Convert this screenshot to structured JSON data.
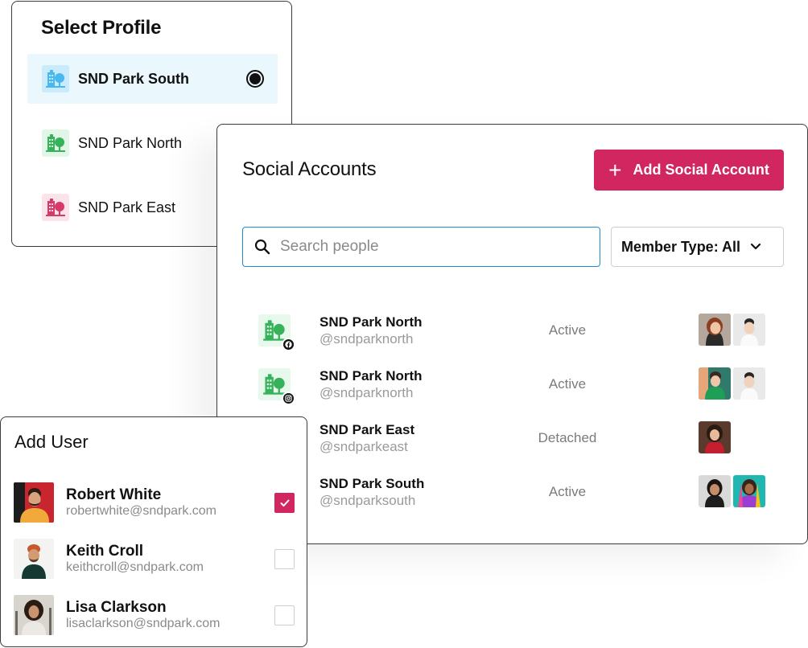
{
  "colors": {
    "accent": "#d1265f",
    "search_border": "#1a8fd6",
    "selected_bg": "#eaf7fd",
    "profile_blue": "#49b8ef",
    "profile_green": "#36b35a",
    "profile_pink": "#d63a6a"
  },
  "select_profile": {
    "title": "Select Profile",
    "items": [
      {
        "name": "SND Park South",
        "icon": "building-tree-icon",
        "color": "blue",
        "selected": true
      },
      {
        "name": "SND Park North",
        "icon": "building-tree-icon",
        "color": "green",
        "selected": false
      },
      {
        "name": "SND Park East",
        "icon": "building-tree-icon",
        "color": "pink",
        "selected": false
      }
    ]
  },
  "social_accounts": {
    "title": "Social Accounts",
    "add_button_label": "Add Social Account",
    "search_placeholder": "Search people",
    "member_type_label": "Member Type: All",
    "accounts": [
      {
        "name": "SND Park North",
        "handle": "@sndparknorth",
        "status": "Active",
        "network_icon": "facebook-icon",
        "members": 2
      },
      {
        "name": "SND Park North",
        "handle": "@sndparknorth",
        "status": "Active",
        "network_icon": "instagram-icon",
        "members": 2
      },
      {
        "name": "SND Park East",
        "handle": "@sndparkeast",
        "status": "Detached",
        "network_icon": "",
        "members": 1
      },
      {
        "name": "SND Park South",
        "handle": "@sndparksouth",
        "status": "Active",
        "network_icon": "",
        "members": 2
      }
    ]
  },
  "add_user": {
    "title": "Add User",
    "users": [
      {
        "name": "Robert White",
        "email": "robertwhite@sndpark.com",
        "checked": true
      },
      {
        "name": "Keith Croll",
        "email": "keithcroll@sndpark.com",
        "checked": false
      },
      {
        "name": "Lisa Clarkson",
        "email": "lisaclarkson@sndpark.com",
        "checked": false
      }
    ]
  }
}
